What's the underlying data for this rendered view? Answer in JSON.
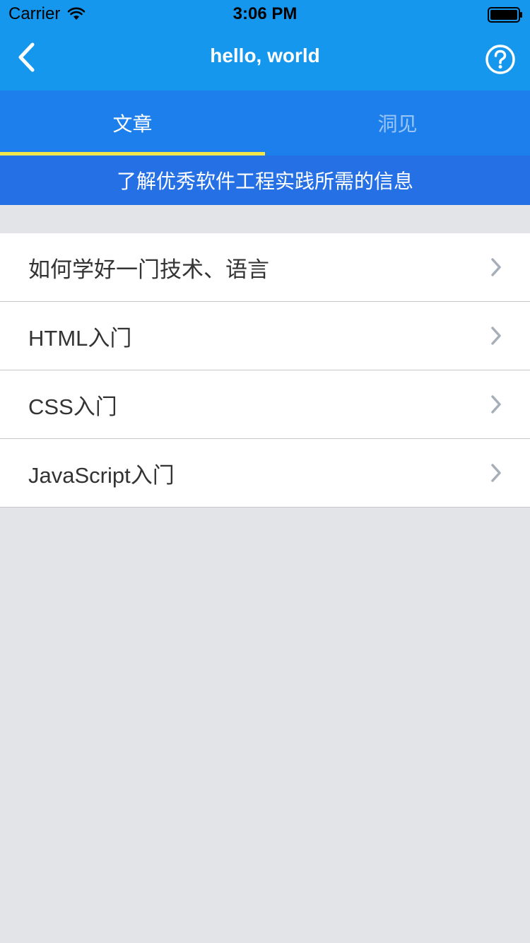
{
  "status_bar": {
    "carrier": "Carrier",
    "time": "3:06 PM"
  },
  "nav": {
    "title": "hello, world",
    "back_icon": "chevron-left-icon",
    "help_icon": "question-circle-icon"
  },
  "tabs": [
    {
      "label": "文章",
      "active": true
    },
    {
      "label": "洞见",
      "active": false
    }
  ],
  "banner": {
    "text": "了解优秀软件工程实践所需的信息"
  },
  "list": {
    "items": [
      {
        "label": "如何学好一门技术、语言"
      },
      {
        "label": "HTML入门"
      },
      {
        "label": "CSS入门"
      },
      {
        "label": "JavaScript入门"
      }
    ]
  },
  "colors": {
    "nav_bg": "#1597ee",
    "tab_bg": "#1d7fec",
    "tab_indicator": "#f2e74a",
    "banner_bg": "#2670e6",
    "page_bg": "#e3e4e8",
    "chevron": "#a6aeb8"
  }
}
